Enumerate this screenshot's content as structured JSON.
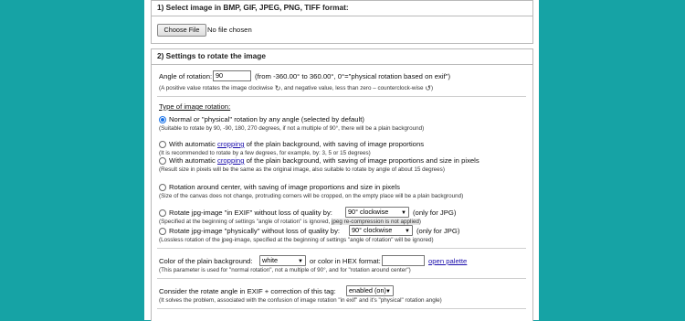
{
  "section1": {
    "title": "1) Select image in BMP, GIF, JPEG, PNG, TIFF format:",
    "choose_button": "Choose File",
    "no_file": "No file chosen"
  },
  "section2": {
    "title": "2) Settings to rotate the image",
    "angle_label": "Angle of rotation:",
    "angle_value": "90",
    "angle_hint": "(from -360.00° to 360.00°, 0°=\"physical rotation based on exif\")",
    "angle_note_a": "(A positive value rotates the image clockwise",
    "angle_note_b": ", and negative value, less than zero – counterclock-wise",
    "angle_note_c": ")",
    "rotation_type_label": "Type of image rotation:",
    "options": [
      {
        "label": "Normal or \"physical\" rotation by any angle (selected by default)",
        "note": "(Suitable to rotate by 90, -90, 180, 270 degrees, if not a multiple of 90°, there will be a plain background)"
      },
      {
        "pre": "With automatic ",
        "link": "cropping",
        "post": " of the plain background, with saving of image proportions",
        "note": "(It is recommended to rotate by a few degrees, for example, by: 3, 5 or 15 degrees)"
      },
      {
        "pre": "With automatic ",
        "link": "cropping",
        "post": " of the plain background, with saving of image proportions and size in pixels",
        "note": "(Result size in pixels will be the same as the original image, also suitable to rotate by angle of about 15 degrees)"
      },
      {
        "label": "Rotation around center, with saving of image proportions and size in pixels",
        "note": "(Size of the canvas does not change, protruding corners will be cropped, on the empty place will be a plain background)"
      },
      {
        "label": "Rotate jpg-image \"in EXIF\" without loss of quality by:",
        "select": "90° clockwise",
        "suffix": "(only for JPG)",
        "note_a": "(Specified at the beginning of settings \"angle of rotation\" is ignored, ",
        "note_b": "jpeg re-compression is not applied",
        "note_c": ")"
      },
      {
        "label": "Rotate jpg-image \"physically\" without loss of quality by:",
        "select": "90° clockwise",
        "suffix": "(only for JPG)",
        "note": "(Lossless rotation of the jpeg-image, specified at the beginning of settings \"angle of rotation\" will be ignored)"
      }
    ],
    "bg_label": "Color of the plain background:",
    "bg_select": "white",
    "bg_hex_label": "or color in HEX format:",
    "bg_hex_value": "",
    "open_palette": "open palette",
    "bg_note": "(This parameter is used for \"normal rotation\", not a multiple of 90°, and for \"rotation around center\")",
    "exif_label": "Consider the rotate angle in EXIF + correction of this tag:",
    "exif_select": "enabled (on)",
    "exif_note": "(It solves the problem, associated with the confusion of image rotation \"in exif\" and it's \"physical\" rotation angle)"
  },
  "colors": {
    "background": "#16a3a5",
    "link": "#1a0dab",
    "radio_selected": "#1a73e8"
  }
}
